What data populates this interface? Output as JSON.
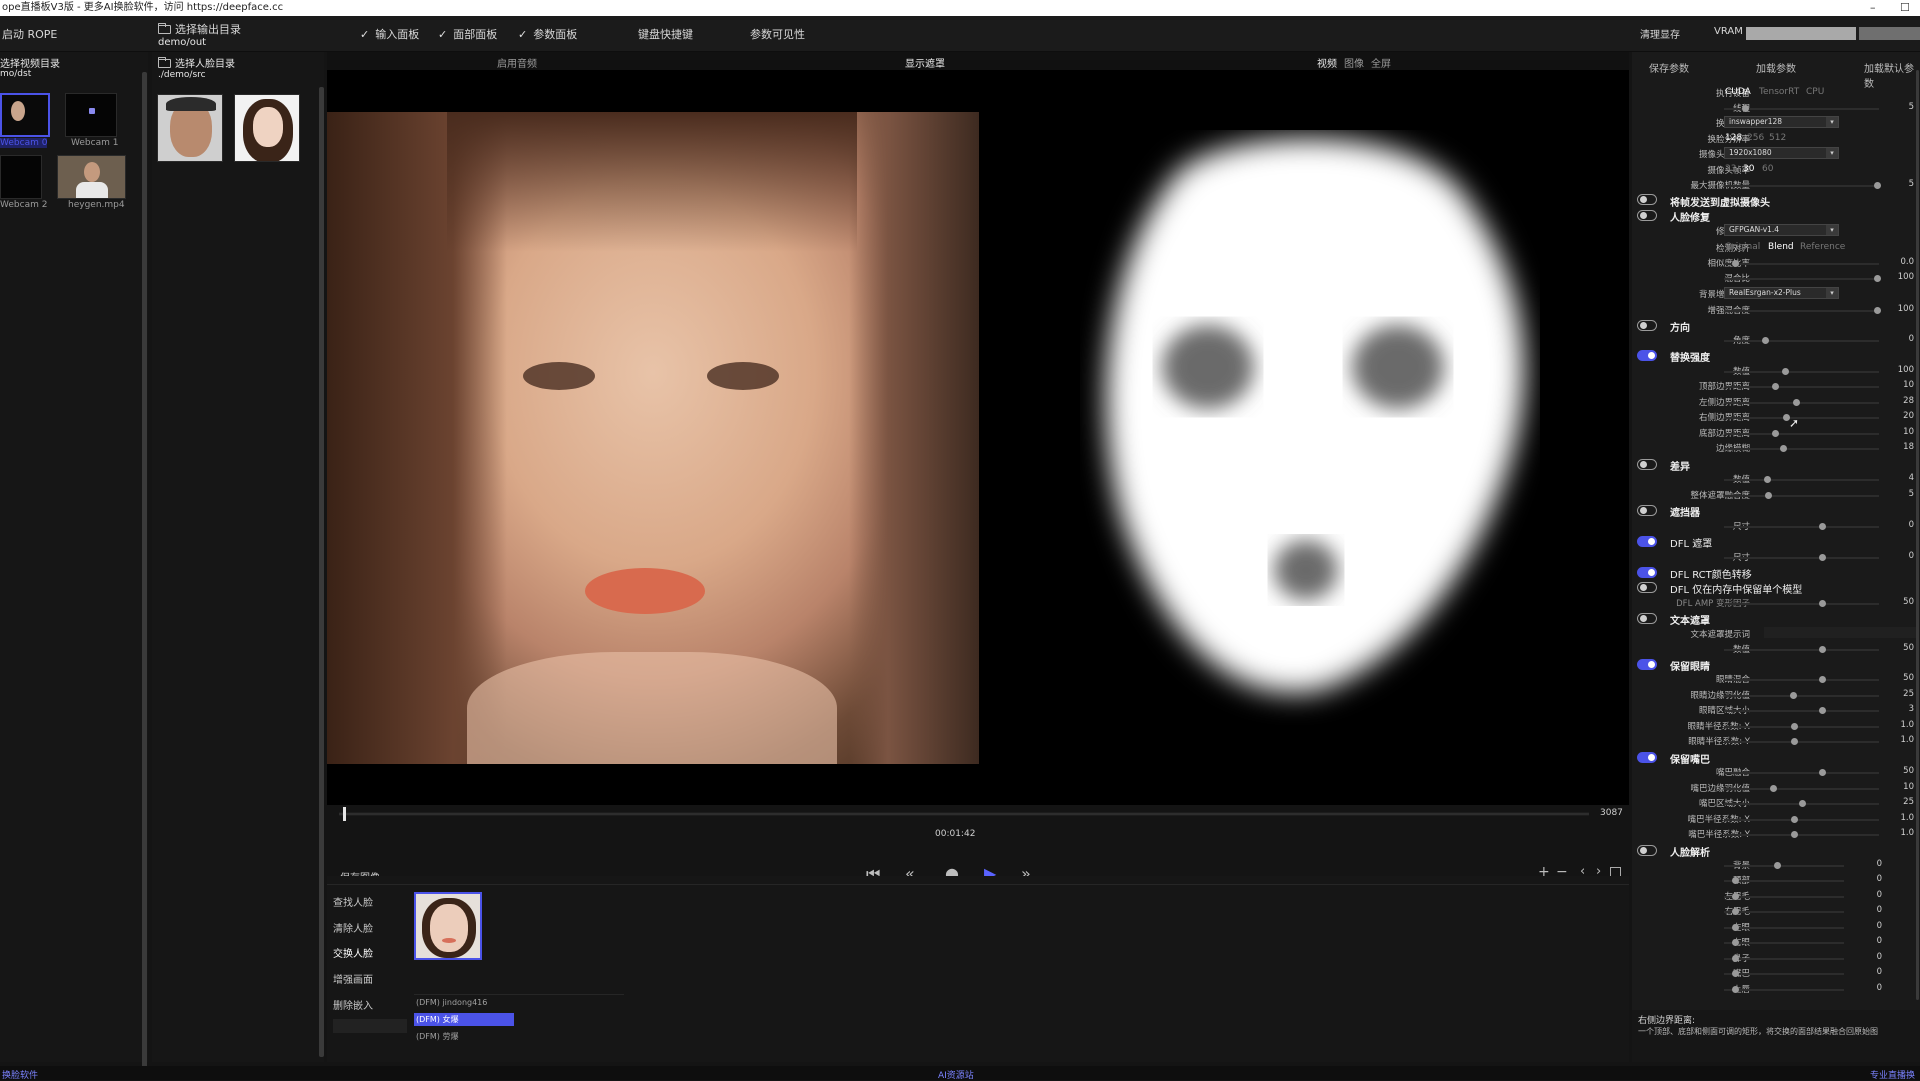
{
  "window": {
    "title": "ope直播板V3版 - 更多AI换脸软件，访问 https://deepface.cc",
    "min": "–",
    "max": "☐"
  },
  "toolbar": {
    "start": "启动 ROPE",
    "output_dir_btn": "选择输出目录",
    "output_dir": "demo/out",
    "input_panel": "输入面板",
    "face_panel": "面部面板",
    "param_panel": "参数面板",
    "hotkeys": "键盘快捷键",
    "param_visibility": "参数可见性",
    "clear_vram": "清理显存",
    "vram": "VRAM",
    "vram_usage": 0.63
  },
  "left": {
    "video_dir_btn": "选择视频目录",
    "video_dir": "mo/dst",
    "face_dir_btn": "选择人脸目录",
    "face_dir": "./demo/src",
    "videos": [
      {
        "caption": "Webcam 0"
      },
      {
        "caption": "Webcam 1"
      },
      {
        "caption": "Webcam 2"
      },
      {
        "caption": "heygen.mp4"
      }
    ]
  },
  "viewer": {
    "audio": "启用音频",
    "show_mask": "显示遮罩",
    "tab_video": "视频",
    "tab_image": "图像",
    "tab_full": "全屏",
    "frame_total": "3087",
    "time": "00:01:42"
  },
  "bottom": {
    "save_image": "保存图像",
    "find_faces": "查找人脸",
    "clear_faces": "清除人脸",
    "swap_faces": "交换人脸",
    "enhance": "增强画面",
    "delete_embed": "删除嵌入",
    "models": [
      "(DFM) jindong416",
      "(DFM) 女爆",
      "(DFM) 劳爆"
    ]
  },
  "params": {
    "save_params": "保存参数",
    "load_params": "加载参数",
    "load_default": "加载默认参数",
    "exec_device": "执行设备",
    "exec_opts": [
      "CUDA",
      "TensorRT",
      "CPU"
    ],
    "threads": "线程",
    "threads_val": "5",
    "swap_model": "换脸模型",
    "swap_model_val": "inswapper128",
    "swap_res": "换脸分辨率",
    "swap_res_opts": [
      "128",
      "256",
      "512"
    ],
    "cam_res": "摄像头分辨率",
    "cam_res_val": "1920x1080",
    "cam_fps": "摄像头帧率",
    "cam_fps_opts": [
      "23",
      "30",
      "60"
    ],
    "max_cams": "最大摄像机数量",
    "max_cams_val": "5",
    "virtual_cam": "将帧发送到虚拟摄像头",
    "face_restore": "人脸修复",
    "restore_model": "修复模型",
    "restore_model_val": "GFPGAN-v1.4",
    "detect_align": "检测对齐",
    "align_opts": [
      "Original",
      "Blend",
      "Reference"
    ],
    "similarity": "相似度比率",
    "similarity_val": "0.0",
    "blend": "混合比",
    "blend_val": "100",
    "bg_model": "背景增强模型",
    "bg_model_val": "RealEsrgan-x2-Plus",
    "enhance_blend": "增强混合度",
    "enhance_blend_val": "100",
    "orientation": "方向",
    "angle": "角度",
    "angle_val": "0",
    "strength": "替换强度",
    "amount": "数值",
    "amount_val": "100",
    "top_border": "顶部边界距离",
    "top_border_val": "10",
    "left_border": "左侧边界距离",
    "left_border_val": "28",
    "right_border": "右侧边界距离",
    "right_border_val": "20",
    "bottom_border": "底部边界距离",
    "bottom_border_val": "10",
    "edge_blur": "边缘模糊",
    "edge_blur_val": "18",
    "diff": "差异",
    "diff_amount": "数值",
    "diff_amount_val": "4",
    "overall_mask": "整体遮罩融合度",
    "overall_mask_val": "5",
    "occluder": "遮挡器",
    "occluder_size": "尺寸",
    "occluder_size_val": "0",
    "dfl_mask": "DFL 遮罩",
    "dfl_size": "尺寸",
    "dfl_size_val": "0",
    "dfl_rct": "DFL RCT颜色转移",
    "dfl_keep_one": "DFL 仅在内存中保留单个模型",
    "dfl_amp": "DFL AMP 变形因子",
    "dfl_amp_val": "50",
    "text_mask": "文本遮罩",
    "text_prompt": "文本遮罩提示词",
    "text_amount": "数值",
    "text_amount_val": "50",
    "keep_eyes": "保留眼睛",
    "eyes_blend": "眼睛混合",
    "eyes_blend_val": "50",
    "eyes_feather": "眼睛边缘羽化值",
    "eyes_feather_val": "25",
    "eyes_size": "眼睛区域大小",
    "eyes_size_val": "3",
    "eyes_rx": "眼睛半径系数: X",
    "eyes_rx_val": "1.0",
    "eyes_ry": "眼睛半径系数: Y",
    "eyes_ry_val": "1.0",
    "keep_mouth": "保留嘴巴",
    "mouth_blend": "嘴巴融合",
    "mouth_blend_val": "50",
    "mouth_feather": "嘴巴边缘羽化值",
    "mouth_feather_val": "10",
    "mouth_size": "嘴巴区域大小",
    "mouth_size_val": "25",
    "mouth_rx": "嘴巴半径系数: X",
    "mouth_rx_val": "1.0",
    "mouth_ry": "嘴巴半径系数: Y",
    "mouth_ry_val": "1.0",
    "face_parse": "人脸解析",
    "bg": "背景",
    "bg_val": "0",
    "neck": "颈部",
    "neck_val": "0",
    "l_brow": "左眉毛",
    "l_brow_val": "0",
    "r_brow": "右眉毛",
    "r_brow_val": "0",
    "l_eye": "左眼",
    "l_eye_val": "0",
    "r_eye": "右眼",
    "r_eye_val": "0",
    "nose": "鼻子",
    "nose_val": "0",
    "mouth": "嘴巴",
    "mouth_val": "0",
    "upper_lip": "上唇",
    "upper_lip_val": "0"
  },
  "help": {
    "title": "右侧边界距离:",
    "text": "一个顶部、底部和侧面可调的矩形，将交换的面部结果融合回原始图"
  },
  "status": {
    "left": "换脸软件",
    "center": "AI资源站",
    "right": "专业直播换"
  },
  "colors": {
    "accent": "#4b53e8",
    "bg": "#141414",
    "panel": "#1a1a1a"
  }
}
